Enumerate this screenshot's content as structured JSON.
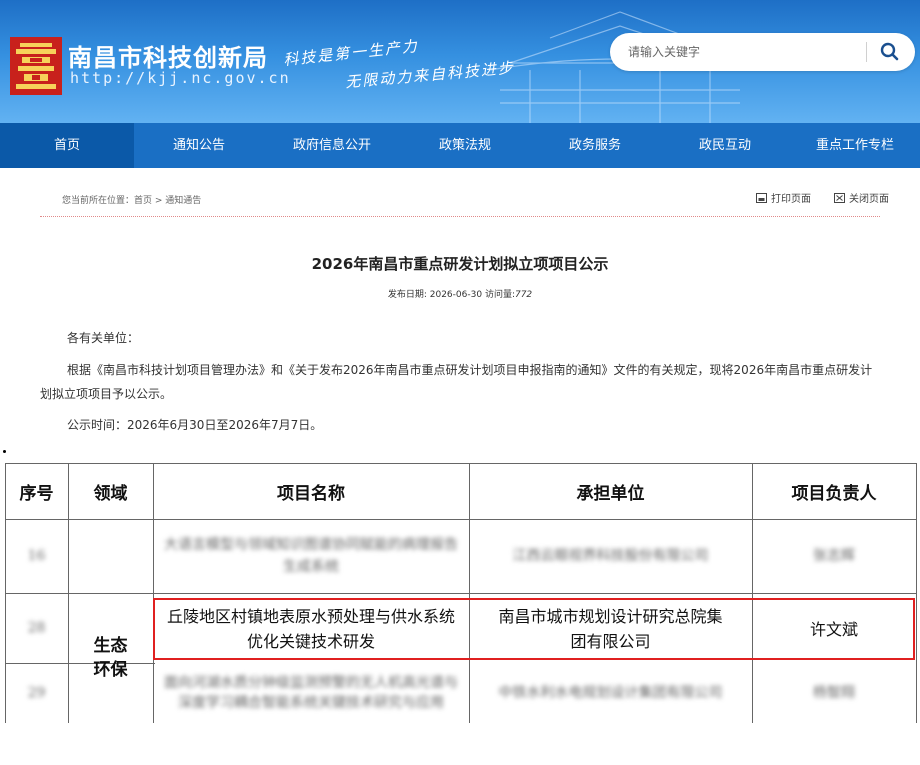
{
  "header": {
    "site_name": "南昌市科技创新局",
    "site_url": "http://kjj.nc.gov.cn",
    "slogan_line1": "科技是第一生产力",
    "slogan_line2": "无限动力来自科技进步",
    "search_placeholder": "请输入关键字"
  },
  "nav": {
    "items": [
      "首页",
      "通知公告",
      "政府信息公开",
      "政策法规",
      "政务服务",
      "政民互动",
      "重点工作专栏"
    ],
    "active_index": 0
  },
  "breadcrumb": "您当前所在位置：首页 > 通知通告",
  "tools": {
    "print": "打印页面",
    "close": "关闭页面"
  },
  "article": {
    "title": "2026年南昌市重点研发计划拟立项项目公示",
    "date_label": "发布日期:",
    "date": "2026-06-30",
    "views_label": "访问量:",
    "views": "772",
    "greeting": "各有关单位：",
    "body_line1": "根据《南昌市科技计划项目管理办法》和《关于发布2026年南昌市重点研发计划项目申报指南的通知》文件的有关规定，现将2026年南昌市重点研发计",
    "body_line2": "划拟立项项目予以公示。",
    "period": "公示时间：2026年6月30日至2026年7月7日。"
  },
  "table": {
    "headers": [
      "序号",
      "领域",
      "项目名称",
      "承担单位",
      "项目负责人"
    ],
    "field_label": "生态环保",
    "rows": [
      {
        "no": "16",
        "name": "大语言模型与领域知识图谱协同赋能的病理报告生成系统",
        "unit": "江西云眼视界科技股份有限公司",
        "leader": "张志辉"
      },
      {
        "no": "28",
        "name": "丘陵地区村镇地表原水预处理与供水系统优化关键技术研发",
        "unit": "南昌市城市规划设计研究总院集团有限公司",
        "leader": "许文斌"
      },
      {
        "no": "29",
        "name": "面向河湖水质分钟级监测预警的无人机高光谱与深度学习耦合智能系统关键技术研究与应用",
        "unit": "中铁水利水电规划设计集团有限公司",
        "leader": "杨智翔"
      }
    ]
  },
  "colors": {
    "nav_bg": "#1a6fc4",
    "nav_active": "#0b59a8",
    "highlight": "#e02020"
  }
}
